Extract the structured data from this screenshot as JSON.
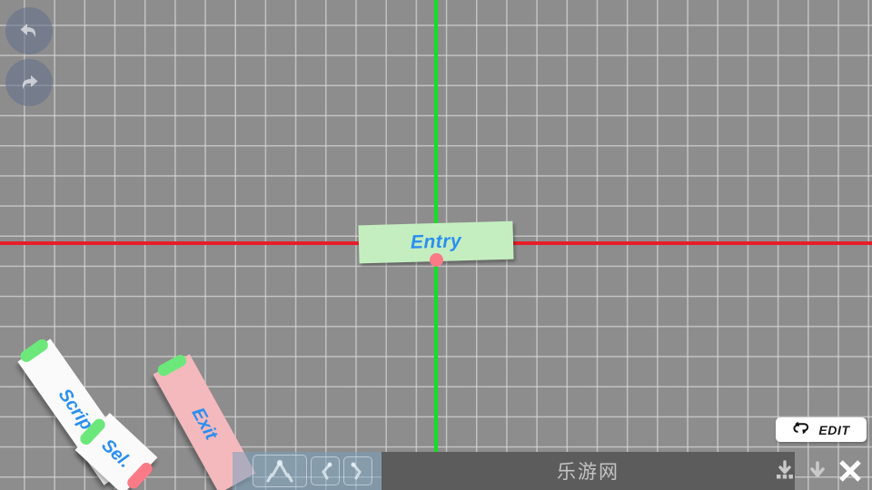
{
  "canvas": {
    "background_color": "#8d8d8d",
    "grid_line_color": "#d7d7d7",
    "grid_spacing_px": 33,
    "axis_vertical_color": "#12e021",
    "axis_horizontal_color": "#e81d2a"
  },
  "entry_node": {
    "label": "Entry",
    "fill_color": "#c4eec0",
    "text_color": "#2a8ff0",
    "port_color": "#fb7a88"
  },
  "history_controls": {
    "undo": {
      "name": "undo",
      "icon": "undo-arrow-icon"
    },
    "redo": {
      "name": "redo",
      "icon": "redo-arrow-icon"
    }
  },
  "scattered_nodes": [
    {
      "label": "Script",
      "fill_color": "#fafafa",
      "text_color": "#2a8ff0",
      "left_port_color": "#6ce87b",
      "right_port_color": "#fb7a88"
    },
    {
      "label": "Sel.",
      "fill_color": "#fafafa",
      "text_color": "#2a8ff0",
      "left_port_color": "#6ce87b",
      "right_port_color": "#fb7a88"
    },
    {
      "label": "Exit",
      "fill_color": "#f4b9bd",
      "text_color": "#2a8ff0",
      "left_port_color": "#6ce87b",
      "right_port_color": "#fb7a88"
    }
  ],
  "edit_button": {
    "label": "EDIT",
    "icon": "cycle-loop-icon",
    "background_color": "#ffffff",
    "text_color": "#1a1a1a"
  },
  "bottom_toolbar": {
    "robot_tools": [
      {
        "icon": "robot-arm-icon"
      },
      {
        "icon": "robot-arm-left-icon"
      },
      {
        "icon": "robot-arm-right-icon"
      }
    ],
    "watermark": "乐游网",
    "watermark_bar_color": "#5c5c5c",
    "actions": [
      {
        "icon": "download-to-box-icon"
      },
      {
        "icon": "download-arrow-icon"
      },
      {
        "icon": "close-x-icon"
      }
    ]
  }
}
